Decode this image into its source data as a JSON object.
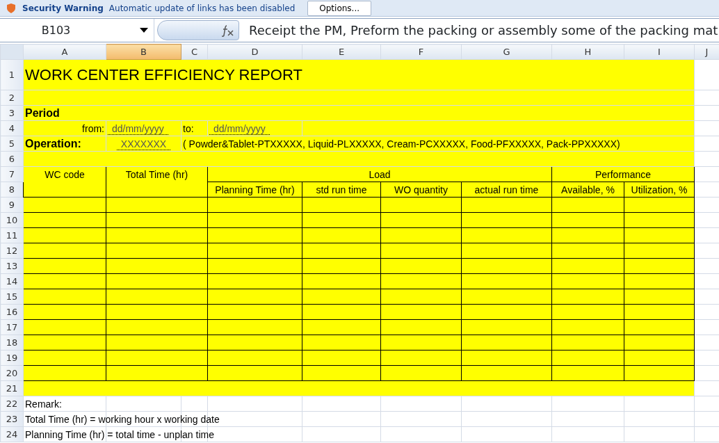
{
  "security_bar": {
    "title": "Security Warning",
    "message": "Automatic update of links has been disabled",
    "button": "Options..."
  },
  "formula_bar": {
    "name_box": "B103",
    "formula": "Receipt the PM, Preform  the packing or assembly some of the packing mat"
  },
  "columns": [
    {
      "label": "A",
      "selected": false
    },
    {
      "label": "B",
      "selected": true
    },
    {
      "label": "C",
      "selected": false
    },
    {
      "label": "D",
      "selected": false
    },
    {
      "label": "E",
      "selected": false
    },
    {
      "label": "F",
      "selected": false
    },
    {
      "label": "G",
      "selected": false
    },
    {
      "label": "H",
      "selected": false
    },
    {
      "label": "I",
      "selected": false
    },
    {
      "label": "J",
      "selected": false
    }
  ],
  "row_headers": [
    "1",
    "2",
    "3",
    "4",
    "5",
    "6",
    "7",
    "8",
    "9",
    "10",
    "11",
    "12",
    "13",
    "14",
    "15",
    "16",
    "17",
    "18",
    "19",
    "20",
    "21",
    "22",
    "23",
    "24"
  ],
  "report": {
    "title": "WORK CENTER EFFICIENCY REPORT",
    "period_label": "Period",
    "from_label": "from:",
    "from_value": "dd/mm/yyyy",
    "to_label": "to:",
    "to_value": "dd/mm/yyyy",
    "operation_label": "Operation:",
    "operation_value": "XXXXXXX",
    "operation_note": "( Powder&Tablet-PTXXXXX, Liquid-PLXXXXX, Cream-PCXXXXX, Food-PFXXXXX, Pack-PPXXXXX)"
  },
  "table": {
    "wc_code": "WC code",
    "total_time": "Total Time (hr)",
    "load": "Load",
    "performance": "Performance",
    "load_columns": [
      "Planning Time (hr)",
      "std run time",
      "WO quantity",
      "actual run time"
    ],
    "performance_columns": [
      "Available, %",
      "Utilization, %"
    ]
  },
  "remarks": [
    "Remark:",
    "Total Time (hr) = working hour x working date",
    "Planning Time (hr) = total time - unplan time"
  ]
}
